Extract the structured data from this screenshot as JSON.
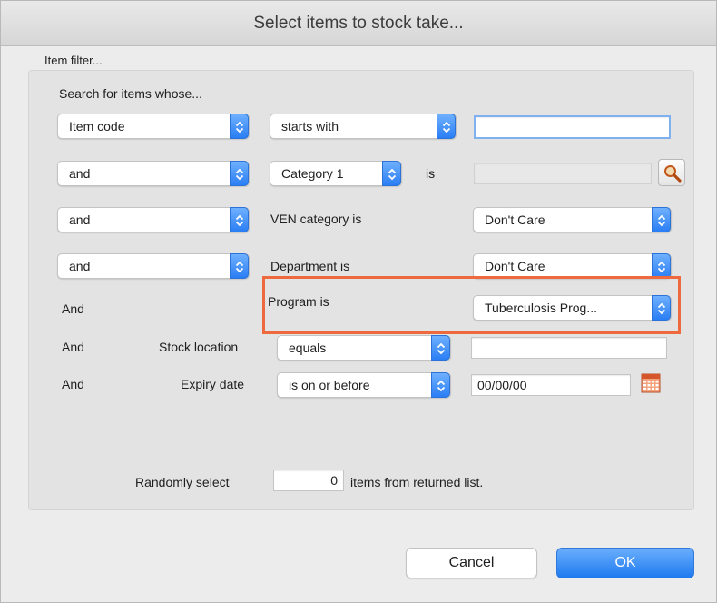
{
  "dialog": {
    "title": "Select items to stock take..."
  },
  "filter": {
    "group_label": "Item filter...",
    "intro": "Search for items whose...",
    "row1": {
      "field": "Item code",
      "operator": "starts with",
      "value": ""
    },
    "row2": {
      "conj": "and",
      "category": "Category 1",
      "is_label": "is",
      "value": ""
    },
    "row3": {
      "conj": "and",
      "label": "VEN category is",
      "value": "Don't Care"
    },
    "row4": {
      "conj": "and",
      "label": "Department is",
      "value": "Don't Care"
    },
    "row5": {
      "conj": "And",
      "label": "Program is",
      "value": "Tuberculosis Prog..."
    },
    "row6": {
      "conj": "And",
      "label": "Stock location",
      "operator": "equals",
      "value": ""
    },
    "row7": {
      "conj": "And",
      "label": "Expiry date",
      "operator": "is on or before",
      "value": "00/00/00"
    },
    "random": {
      "prefix": "Randomly select",
      "count": "0",
      "suffix": "items from returned list."
    }
  },
  "buttons": {
    "cancel": "Cancel",
    "ok": "OK"
  },
  "colors": {
    "accent": "#2a7ef4",
    "highlight": "#ee6a3e"
  },
  "icons": {
    "search_button": "magnifier-icon",
    "date_button": "calendar-icon",
    "popup_arrows": "up-down-chevron-icon"
  }
}
